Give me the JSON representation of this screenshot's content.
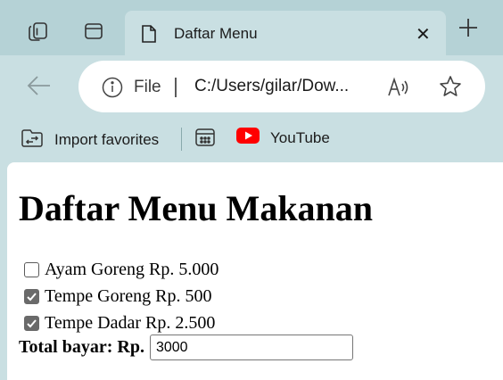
{
  "browser": {
    "tab": {
      "title": "Daftar Menu"
    },
    "address": {
      "scheme_label": "File",
      "url": "C:/Users/gilar/Dow..."
    },
    "favorites": {
      "import_label": "Import favorites",
      "youtube_label": "YouTube"
    },
    "colors": {
      "frame": "#c9dfe2",
      "tabstrip": "#b5d2d6",
      "youtube_red": "#ff0000"
    }
  },
  "page": {
    "title": "Daftar Menu Makanan",
    "menu_items": [
      {
        "label": "Ayam Goreng Rp. 5.000",
        "checked": false
      },
      {
        "label": "Tempe Goreng Rp. 500",
        "checked": true
      },
      {
        "label": "Tempe Dadar Rp. 2.500",
        "checked": true
      }
    ],
    "total": {
      "label": "Total bayar: Rp.",
      "value": "3000"
    }
  }
}
